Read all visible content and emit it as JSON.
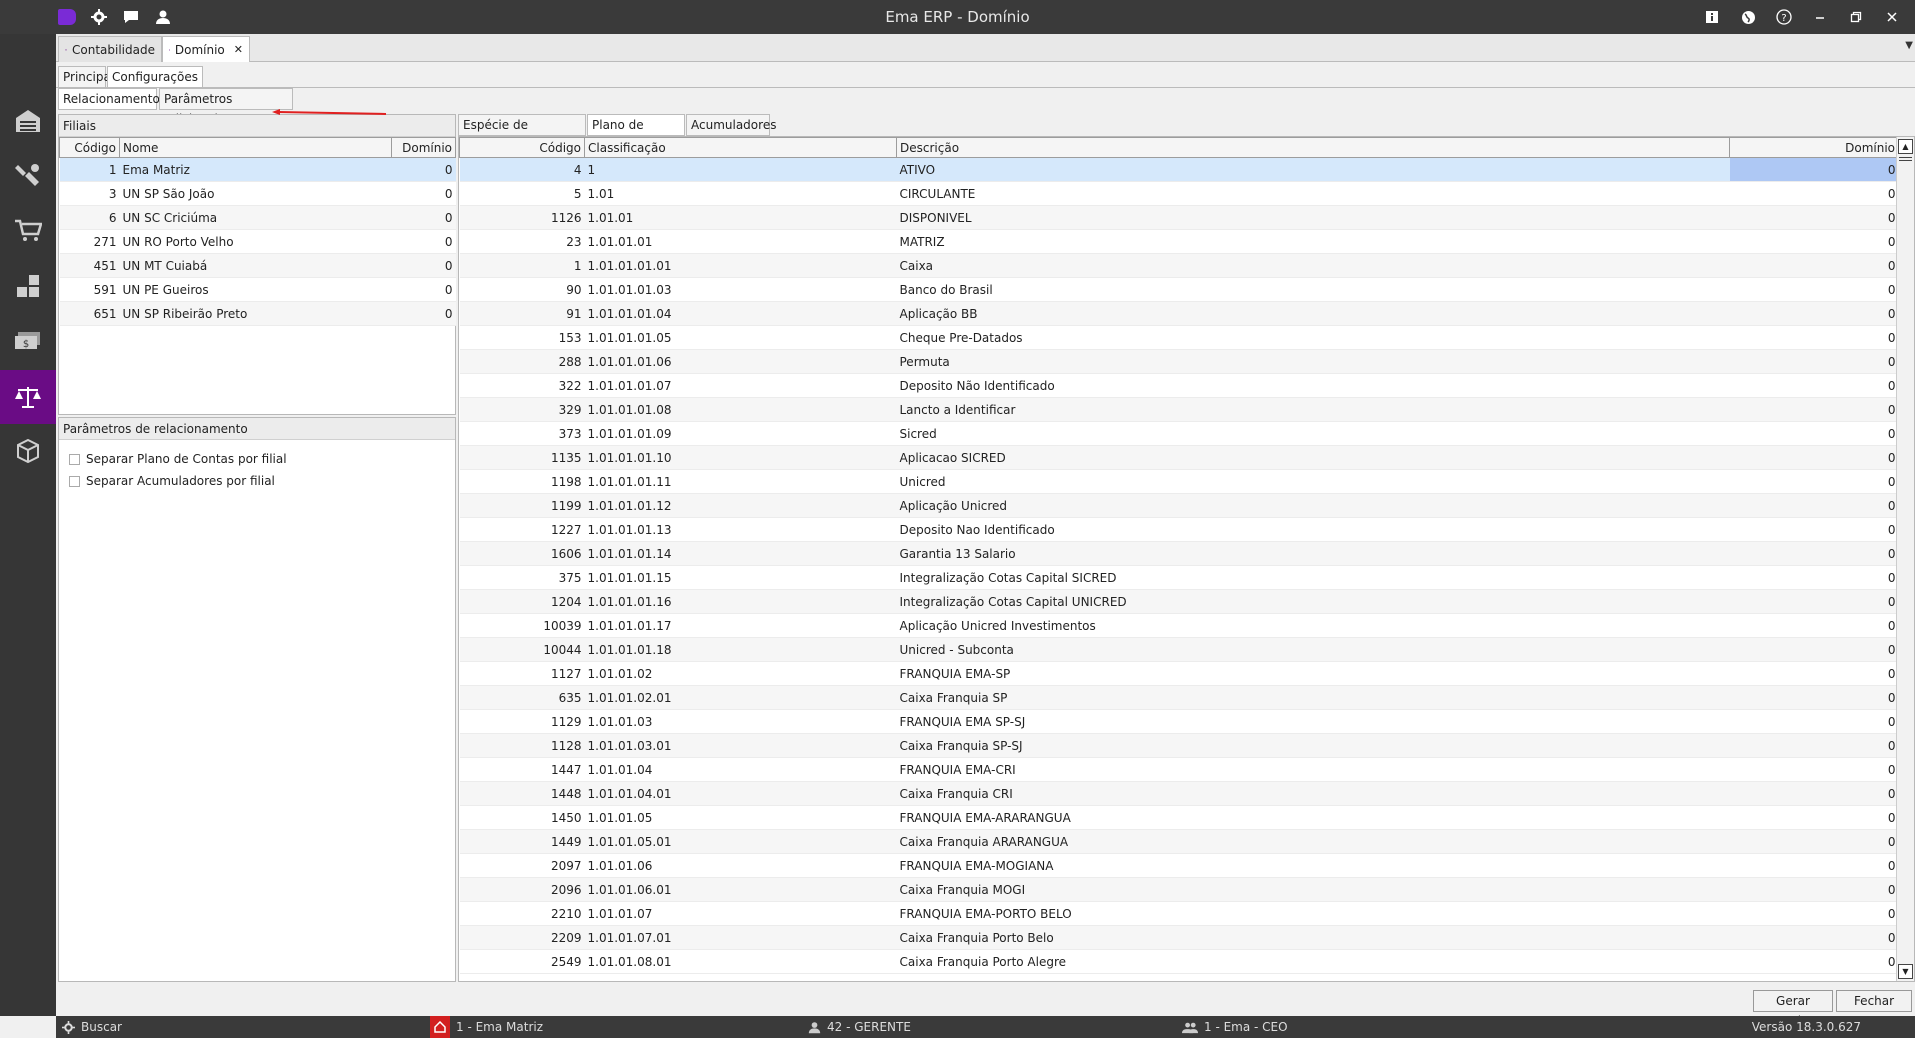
{
  "window": {
    "title": "Ema ERP - Domínio"
  },
  "titlebar_icons": {
    "left": [
      "app-logo-icon",
      "gear-icon",
      "chat-icon",
      "user-icon"
    ],
    "right": [
      "info-icon",
      "globe-icon",
      "help-icon",
      "minimize-icon",
      "restore-icon",
      "close-icon"
    ]
  },
  "sidebar": {
    "items": [
      "warehouse-icon",
      "tools-icon",
      "cart-icon",
      "boxes-icon",
      "money-icon",
      "scale-icon",
      "package-icon"
    ],
    "active": "scale-icon",
    "active_color": "#6a0c85"
  },
  "doc_tabs": [
    {
      "label": "Contabilidade",
      "icon": "scale-icon"
    },
    {
      "label": "Domínio",
      "icon": "folder-icon",
      "close": "✕"
    }
  ],
  "sub_tabs": [
    "Principal",
    "Configurações"
  ],
  "sub_tabs2": [
    "Relacionamentos",
    "Parâmetros adicionais"
  ],
  "filiais": {
    "title": "Filiais",
    "columns": [
      "Código",
      "Nome",
      "Domínio"
    ],
    "rows": [
      {
        "codigo": "1",
        "nome": "Ema Matriz",
        "dominio": "0"
      },
      {
        "codigo": "3",
        "nome": "UN SP São João",
        "dominio": "0"
      },
      {
        "codigo": "6",
        "nome": "UN SC Criciúma",
        "dominio": "0"
      },
      {
        "codigo": "271",
        "nome": "UN RO Porto Velho",
        "dominio": "0"
      },
      {
        "codigo": "451",
        "nome": "UN MT Cuiabá",
        "dominio": "0"
      },
      {
        "codigo": "591",
        "nome": "UN PE Gueiros",
        "dominio": "0"
      },
      {
        "codigo": "651",
        "nome": "UN SP Ribeirão Preto",
        "dominio": "0"
      }
    ]
  },
  "parametros": {
    "title": "Parâmetros de relacionamento",
    "options": [
      "Separar Plano de Contas por filial",
      "Separar Acumuladores por filial"
    ]
  },
  "right_tabs": [
    "Espécie de documento",
    "Plano de contas",
    "Acumuladores"
  ],
  "plano": {
    "columns": [
      "Código",
      "Classificação",
      "Descrição",
      "Domínio"
    ],
    "rows": [
      [
        "4",
        "1",
        "ATIVO",
        "0"
      ],
      [
        "5",
        "1.01",
        "CIRCULANTE",
        "0"
      ],
      [
        "1126",
        "1.01.01",
        "DISPONIVEL",
        "0"
      ],
      [
        "23",
        "1.01.01.01",
        "MATRIZ",
        "0"
      ],
      [
        "1",
        "1.01.01.01.01",
        "Caixa",
        "0"
      ],
      [
        "90",
        "1.01.01.01.03",
        "Banco do Brasil",
        "0"
      ],
      [
        "91",
        "1.01.01.01.04",
        "Aplicação BB",
        "0"
      ],
      [
        "153",
        "1.01.01.01.05",
        "Cheque Pre-Datados",
        "0"
      ],
      [
        "288",
        "1.01.01.01.06",
        "Permuta",
        "0"
      ],
      [
        "322",
        "1.01.01.01.07",
        "Deposito Não Identificado",
        "0"
      ],
      [
        "329",
        "1.01.01.01.08",
        "Lancto a Identificar",
        "0"
      ],
      [
        "373",
        "1.01.01.01.09",
        "Sicred",
        "0"
      ],
      [
        "1135",
        "1.01.01.01.10",
        "Aplicacao SICRED",
        "0"
      ],
      [
        "1198",
        "1.01.01.01.11",
        "Unicred",
        "0"
      ],
      [
        "1199",
        "1.01.01.01.12",
        "Aplicação Unicred",
        "0"
      ],
      [
        "1227",
        "1.01.01.01.13",
        "Deposito Nao Identificado",
        "0"
      ],
      [
        "1606",
        "1.01.01.01.14",
        "Garantia 13 Salario",
        "0"
      ],
      [
        "375",
        "1.01.01.01.15",
        "Integralização Cotas Capital  SICRED",
        "0"
      ],
      [
        "1204",
        "1.01.01.01.16",
        "Integralização Cotas Capital  UNICRED",
        "0"
      ],
      [
        "10039",
        "1.01.01.01.17",
        "Aplicação Unicred Investimentos",
        "0"
      ],
      [
        "10044",
        "1.01.01.01.18",
        "Unicred - Subconta",
        "0"
      ],
      [
        "1127",
        "1.01.01.02",
        "FRANQUIA EMA-SP",
        "0"
      ],
      [
        "635",
        "1.01.01.02.01",
        "Caixa Franquia SP",
        "0"
      ],
      [
        "1129",
        "1.01.01.03",
        "FRANQUIA EMA SP-SJ",
        "0"
      ],
      [
        "1128",
        "1.01.01.03.01",
        "Caixa Franquia SP-SJ",
        "0"
      ],
      [
        "1447",
        "1.01.01.04",
        "FRANQUIA EMA-CRI",
        "0"
      ],
      [
        "1448",
        "1.01.01.04.01",
        "Caixa Franquia CRI",
        "0"
      ],
      [
        "1450",
        "1.01.01.05",
        "FRANQUIA EMA-ARARANGUA",
        "0"
      ],
      [
        "1449",
        "1.01.01.05.01",
        "Caixa Franquia ARARANGUA",
        "0"
      ],
      [
        "2097",
        "1.01.01.06",
        "FRANQUIA EMA-MOGIANA",
        "0"
      ],
      [
        "2096",
        "1.01.01.06.01",
        "Caixa Franquia MOGI",
        "0"
      ],
      [
        "2210",
        "1.01.01.07",
        "FRANQUIA EMA-PORTO BELO",
        "0"
      ],
      [
        "2209",
        "1.01.01.07.01",
        "Caixa Franquia Porto Belo",
        "0"
      ],
      [
        "2549",
        "1.01.01.08.01",
        "Caixa Franquia Porto Alegre",
        "0"
      ]
    ]
  },
  "buttons": {
    "gerar": "Gerar arquivo",
    "fechar": "Fechar"
  },
  "status": {
    "search": "Buscar",
    "branch": "1 - Ema Matriz",
    "user": "42 - GERENTE",
    "company": "1 - Ema - CEO",
    "version": "Versão 18.3.0.627"
  },
  "colors": {
    "accent": "#6a0c85",
    "selection": "#d5e8fb",
    "annotation_arrow": "#e02020",
    "home_badge": "#d21f1f"
  }
}
